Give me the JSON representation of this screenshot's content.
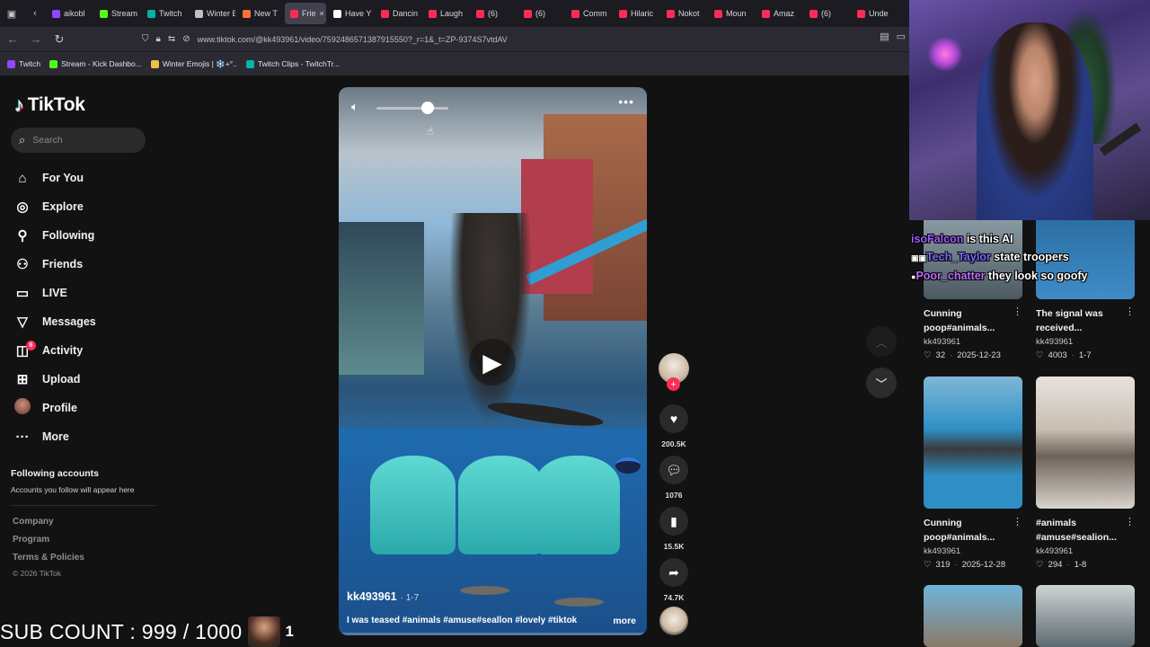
{
  "browser": {
    "tabs": [
      {
        "label": "aikobl",
        "color": "#9146ff"
      },
      {
        "label": "Stream",
        "color": "#53fc18"
      },
      {
        "label": "Twitch",
        "color": "#00b5a8"
      },
      {
        "label": "Winter Em",
        "color": "#c0c0c0"
      },
      {
        "label": "New T",
        "color": "#ff7139"
      },
      {
        "label": "Frie",
        "color": "#fe2c55",
        "active": true
      },
      {
        "label": "Have Y",
        "color": "#ffffff"
      },
      {
        "label": "Dancin",
        "color": "#fe2c55"
      },
      {
        "label": "Laugh",
        "color": "#fe2c55"
      },
      {
        "label": "(6)",
        "color": "#fe2c55"
      },
      {
        "label": "(6)",
        "color": "#fe2c55"
      },
      {
        "label": "Comm",
        "color": "#fe2c55"
      },
      {
        "label": "Hilaric",
        "color": "#fe2c55"
      },
      {
        "label": "Nokot",
        "color": "#fe2c55"
      },
      {
        "label": "Moun",
        "color": "#fe2c55"
      },
      {
        "label": "Amaz",
        "color": "#fe2c55"
      },
      {
        "label": "(6)",
        "color": "#fe2c55"
      },
      {
        "label": "Unde",
        "color": "#fe2c55"
      }
    ],
    "url": "www.tiktok.com/@kk493961/video/7592486571387915550?_r=1&_t=ZP-9374S7vtdAV",
    "bookmarks": [
      {
        "label": "Twitch",
        "color": "#9146ff"
      },
      {
        "label": "Stream - Kick Dashbo...",
        "color": "#53fc18"
      },
      {
        "label": "Winter Emojis | ❄️+°..",
        "color": "#f0c040"
      },
      {
        "label": "Twitch Clips - TwitchTr...",
        "color": "#00b5a8"
      }
    ]
  },
  "tiktok": {
    "brand": "TikTok",
    "search_placeholder": "Search",
    "menu": [
      {
        "label": "For You",
        "icon": "home-icon"
      },
      {
        "label": "Explore",
        "icon": "compass-icon"
      },
      {
        "label": "Following",
        "icon": "following-icon"
      },
      {
        "label": "Friends",
        "icon": "friends-icon"
      },
      {
        "label": "LIVE",
        "icon": "live-icon"
      },
      {
        "label": "Messages",
        "icon": "messages-icon"
      },
      {
        "label": "Activity",
        "icon": "activity-icon",
        "badge": "6"
      },
      {
        "label": "Upload",
        "icon": "upload-icon"
      },
      {
        "label": "Profile",
        "icon": "profile-avatar"
      },
      {
        "label": "More",
        "icon": "more-icon"
      }
    ],
    "following_title": "Following accounts",
    "following_desc": "Accounts you follow will appear here",
    "footer": [
      "Company",
      "Program",
      "Terms & Policies"
    ],
    "copyright": "© 2026 TikTok"
  },
  "video": {
    "author": "kk493961",
    "date": "· 1-7",
    "caption": "I was teased #animals #amuse#seallon #lovely #tiktok",
    "more_label": "more",
    "likes": "200.5K",
    "comments": "1076",
    "saves": "15.5K",
    "shares": "74.7K"
  },
  "related": [
    {
      "title": "Cunning poop#animals...",
      "author": "kk493961",
      "likes": "32",
      "date": "2025-12-23"
    },
    {
      "title": "The signal was received...",
      "author": "kk493961",
      "likes": "4003",
      "date": "1-7"
    },
    {
      "title": "Cunning poop#animals...",
      "author": "kk493961",
      "likes": "319",
      "date": "2025-12-28"
    },
    {
      "title": "#animals #amuse#sealion...",
      "author": "kk493961",
      "likes": "294",
      "date": "1-8"
    }
  ],
  "chat": [
    {
      "user": "isoFalcon",
      "message": " is this AI"
    },
    {
      "user": "Tech_Taylor",
      "message": " state troopers"
    },
    {
      "user": "Poor_chatter",
      "message": " they look so goofy"
    }
  ],
  "overlay": {
    "sub_count": "SUB COUNT : 999 / 1000",
    "sub_number": "1"
  }
}
